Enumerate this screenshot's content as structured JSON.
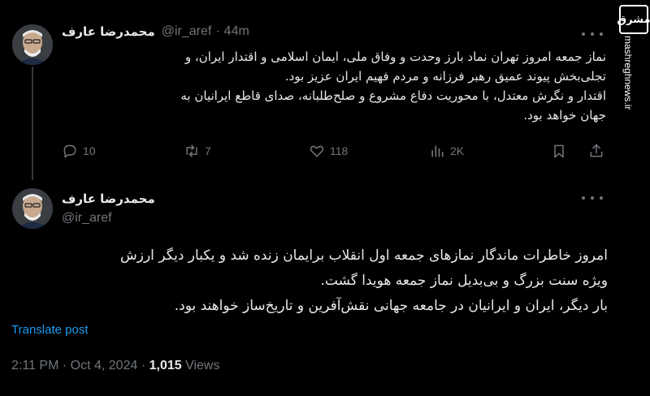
{
  "tweet": {
    "author_name": "محمدرضا عارف",
    "handle": "@ir_aref",
    "separator": "·",
    "time_ago": "44m",
    "lines": [
      "نماز جمعه امروز تهران نماد بارز وحدت و وفاق ملی، ایمان اسلامی و اقتدار ایران، و",
      "تجلی‌بخش پیوند عمیق رهبر فرزانه و مردم فهیم ایران عزیز بود.",
      "اقتدار و نگرش معتدل، با محوریت دفاع مشروع و صلح‌طلبانه، صدای قاطع ایرانیان به",
      "جهان خواهد بود."
    ],
    "replies": "10",
    "reposts": "7",
    "likes": "118",
    "views": "2K"
  },
  "post": {
    "author_name": "محمدرضا عارف",
    "handle": "@ir_aref",
    "lines": [
      "امروز خاطرات ماندگار نمازهای جمعه اول انقلاب برایمان زنده شد و یکبار دیگر ارزش",
      "ویژه سنت بزرگ و بی‌بدیل نماز جمعه هویدا گشت.",
      "بار دیگر، ایران و ایرانیان در جامعه جهانی نقش‌آفرین و تاریخ‌ساز خواهند بود."
    ],
    "translate_label": "Translate post",
    "time": "2:11 PM",
    "separator": "·",
    "date": "Oct 4, 2024",
    "views_count": "1,015",
    "views_label": "Views"
  },
  "watermark": {
    "logo_text": "مشرق",
    "url": "mashreghnews.ir"
  },
  "icons": [
    "reply-icon",
    "repost-icon",
    "like-icon",
    "views-icon",
    "bookmark-icon",
    "share-icon",
    "more-icon"
  ],
  "colors": {
    "background": "#000000",
    "text": "#e7e9ea",
    "muted": "#71767b",
    "link": "#1d9bf0"
  }
}
